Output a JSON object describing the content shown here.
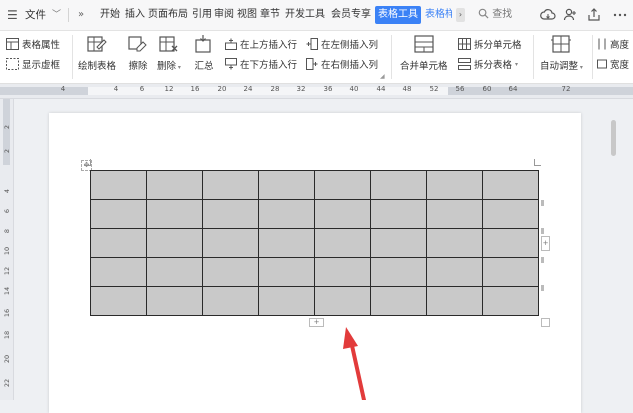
{
  "menubar": {
    "file_label": "文件",
    "more_label": "»",
    "tabs": [
      "开始",
      "插入",
      "页面布局",
      "引用",
      "审阅",
      "视图",
      "章节",
      "开发工具",
      "会员专享",
      "表格工具",
      "表格样"
    ],
    "active_tab": "表格工具",
    "search_label": "查找"
  },
  "ribbon": {
    "table_props": "表格属性",
    "show_borders": "显示虚框",
    "draw_table": "绘制表格",
    "erase": "擦除",
    "delete": "删除",
    "summary": "汇总",
    "insert_row_above": "在上方插入行",
    "insert_row_below": "在下方插入行",
    "insert_col_left": "在左侧插入列",
    "insert_col_right": "在右侧插入列",
    "merge_cells": "合并单元格",
    "split_cells": "拆分单元格",
    "split_table": "拆分表格",
    "auto_fit": "自动调整",
    "height_label": "高度",
    "width_label": "宽度"
  },
  "ruler": {
    "h_numbers": [
      "4",
      "4",
      "6",
      "12",
      "16",
      "20",
      "24",
      "28",
      "32",
      "36",
      "40",
      "44",
      "48",
      "52",
      "56",
      "60",
      "64",
      "72"
    ],
    "v_numbers": [
      "2",
      "2",
      "4",
      "6",
      "8",
      "10",
      "12",
      "14",
      "16",
      "18",
      "20",
      "22"
    ]
  },
  "table": {
    "rows": 5,
    "cols": 8
  },
  "colors": {
    "accent": "#3b82f6",
    "cell_fill": "#c9c9c9",
    "arrow": "#e23b3b"
  }
}
